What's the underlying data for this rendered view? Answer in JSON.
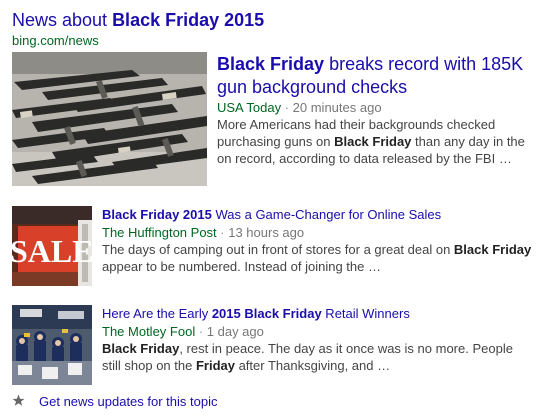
{
  "header": {
    "title_prefix": "News about ",
    "title_query": "Black Friday 2015",
    "source_url": "bing.com/news"
  },
  "lead": {
    "image_alt": "Rows of rifles displayed on a table",
    "title_bold": "Black Friday",
    "title_rest": " breaks record with 185K gun background checks",
    "source": "USA Today",
    "separator": " · ",
    "age": "20 minutes ago",
    "snippet_a": "More Americans had their backgrounds checked purchasing guns on ",
    "snippet_bold": "Black Friday",
    "snippet_b": " than any day in the on record, according to data released by the FBI …"
  },
  "items": [
    {
      "image_alt": "Red SALE sign in a store window",
      "image_text": "SALE",
      "title_bold": "Black Friday 2015",
      "title_rest": " Was a Game-Changer for Online Sales",
      "source": "The Huffington Post",
      "separator": " · ",
      "age": "13 hours ago",
      "snippet_a": "The days of camping out in front of stores for a great deal on ",
      "snippet_bold": "Black Friday",
      "snippet_b": " appear to be numbered. Instead of joining the …"
    },
    {
      "image_alt": "Crowd of shoppers inside a store",
      "title_a": "Here Are the Early ",
      "title_bold": "2015 Black Friday",
      "title_b": " Retail Winners",
      "source": "The Motley Fool",
      "separator": " · ",
      "age": "1 day ago",
      "snippet_bold1": "Black Friday",
      "snippet_a": ", rest in peace. The day as it once was is no more. People still shop on the ",
      "snippet_bold2": "Friday",
      "snippet_b": " after Thanksgiving, and …"
    }
  ],
  "footer": {
    "icon": "star-icon",
    "link_label": "Get news updates for this topic"
  },
  "colors": {
    "link": "#1a0dab",
    "source_green": "#006621",
    "meta_gray": "#777777",
    "snippet": "#444444"
  }
}
